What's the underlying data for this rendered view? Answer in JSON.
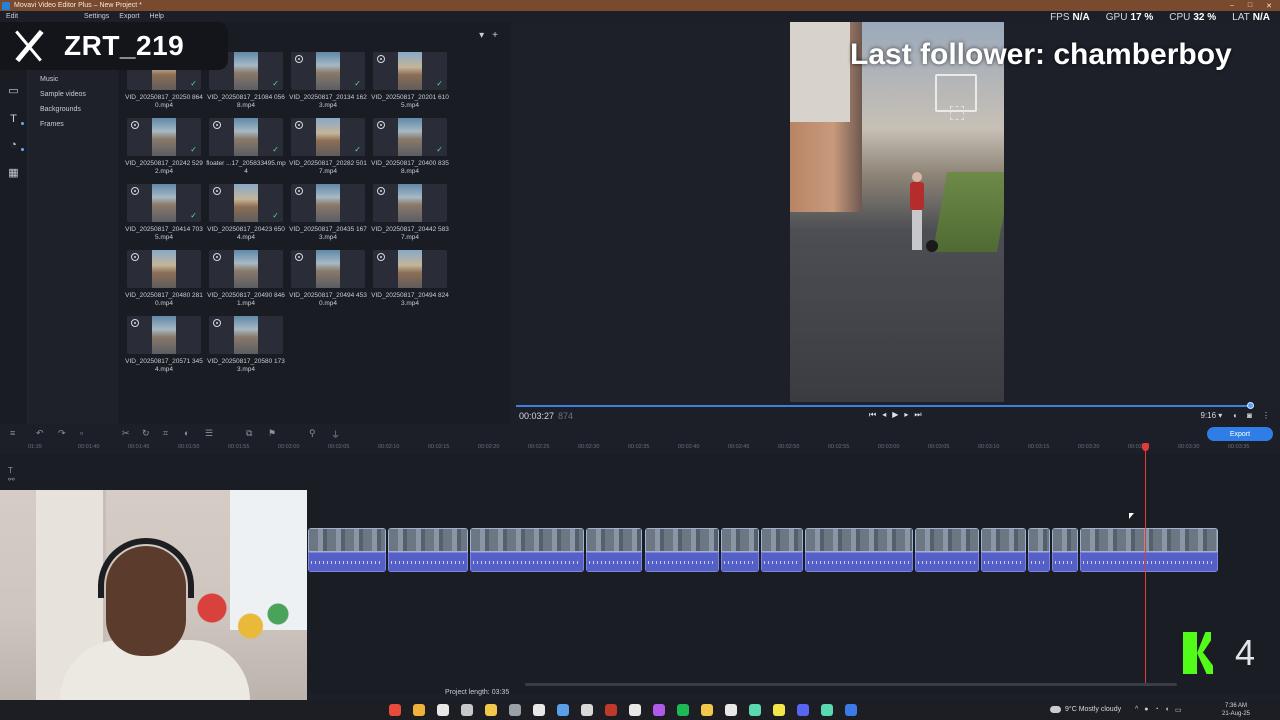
{
  "window": {
    "title": "Movavi Video Editor Plus – New Project *",
    "controls": [
      "–",
      "□",
      "✕"
    ]
  },
  "menu": [
    "Edit",
    "Settings",
    "Export",
    "Help"
  ],
  "stats": [
    {
      "label": "FPS",
      "value": "N/A"
    },
    {
      "label": "GPU",
      "value": "17 %"
    },
    {
      "label": "CPU",
      "value": "32 %"
    },
    {
      "label": "LAT",
      "value": "N/A"
    }
  ],
  "overlay": {
    "x_handle": "ZRT_219",
    "last_follower": "Last follower: chamberboy",
    "kick_count": "4"
  },
  "categories": [
    "Music",
    "Sample videos",
    "Backgrounds",
    "Frames"
  ],
  "media": [
    {
      "name": "VID_20250817_20250 8640.mp4",
      "circle": false,
      "check": true
    },
    {
      "name": "VID_20250817_21084 0568.mp4",
      "circle": false,
      "check": true
    },
    {
      "name": "VID_20250817_20134 1623.mp4",
      "circle": true,
      "check": true
    },
    {
      "name": "VID_20250817_20201 6105.mp4",
      "circle": true,
      "check": true
    },
    {
      "name": "VID_20250817_20242 5292.mp4",
      "circle": true,
      "check": true
    },
    {
      "name": "floater ...17_205833495.mp4",
      "circle": true,
      "check": true
    },
    {
      "name": "VID_20250817_20282 5017.mp4",
      "circle": true,
      "check": true
    },
    {
      "name": "VID_20250817_20400 8358.mp4",
      "circle": true,
      "check": true
    },
    {
      "name": "VID_20250817_20414 7035.mp4",
      "circle": true,
      "check": true
    },
    {
      "name": "VID_20250817_20423 6504.mp4",
      "circle": true,
      "check": true
    },
    {
      "name": "VID_20250817_20435 1673.mp4",
      "circle": true,
      "check": false
    },
    {
      "name": "VID_20250817_20442 5837.mp4",
      "circle": true,
      "check": false
    },
    {
      "name": "VID_20250817_20480 2810.mp4",
      "circle": true,
      "check": false
    },
    {
      "name": "VID_20250817_20490 8461.mp4",
      "circle": true,
      "check": false
    },
    {
      "name": "VID_20250817_20494 4530.mp4",
      "circle": true,
      "check": false
    },
    {
      "name": "VID_20250817_20494 8243.mp4",
      "circle": true,
      "check": false
    },
    {
      "name": "VID_20250817_20571 3454.mp4",
      "circle": true,
      "check": false
    },
    {
      "name": "VID_20250817_20580 1733.mp4",
      "circle": true,
      "check": false
    }
  ],
  "player": {
    "time": "00:03:27",
    "frame": "874",
    "aspect": "9:16 ▾",
    "progress": 1.0
  },
  "export_label": "Export",
  "ruler_ticks": [
    "01:35",
    "00:01:40",
    "00:01:45",
    "00:01:50",
    "00:01:55",
    "00:02:00",
    "00:02:05",
    "00:02:10",
    "00:02:15",
    "00:02:20",
    "00:02:25",
    "00:02:30",
    "00:02:35",
    "00:02:40",
    "00:02:45",
    "00:02:50",
    "00:02:55",
    "00:03:00",
    "00:03:05",
    "00:03:10",
    "00:03:15",
    "00:03:20",
    "00:03:25",
    "00:03:30",
    "00:03:35"
  ],
  "project_length": "Project length:  03:35",
  "taskbar": {
    "weather": "9°C  Mostly cloudy",
    "time": "7:36 AM",
    "date": "21-Aug-25"
  },
  "colors": {
    "accent": "#2f7ee8",
    "playhead": "#e03b3b",
    "audio": "#5560c6",
    "kick": "#53fc18",
    "titlebar": "#7a4a2e"
  }
}
